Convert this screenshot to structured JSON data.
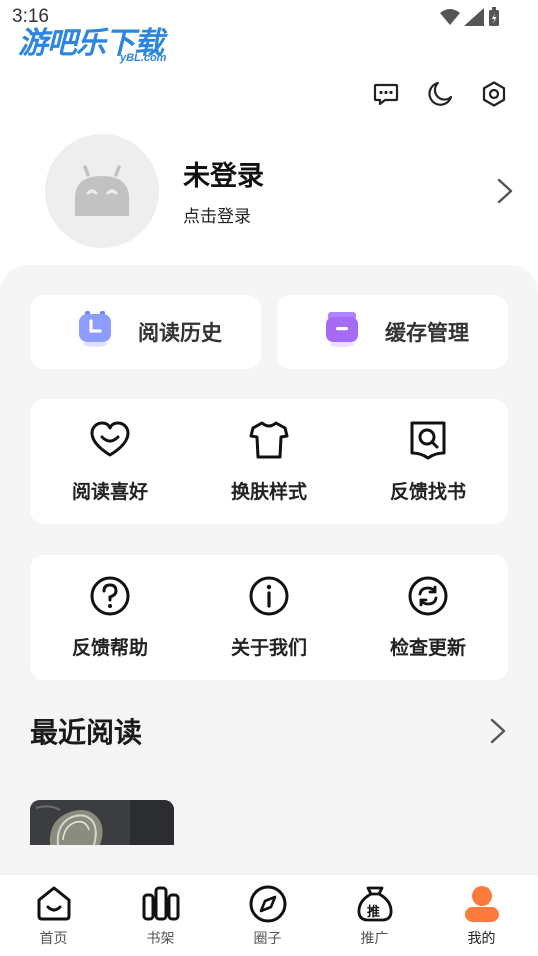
{
  "status_bar": {
    "time": "3:16"
  },
  "watermark": {
    "text": "游吧乐下载",
    "sub": "yBL.com"
  },
  "top_actions": [
    {
      "icon": "message-icon"
    },
    {
      "icon": "moon-icon"
    },
    {
      "icon": "settings-icon"
    }
  ],
  "profile": {
    "name": "未登录",
    "subtitle": "点击登录"
  },
  "quick_actions": [
    {
      "label": "阅读历史",
      "icon": "history-clock-icon",
      "color": "#7b8cff"
    },
    {
      "label": "缓存管理",
      "icon": "cache-box-icon",
      "color": "#b47cff"
    }
  ],
  "grid1": [
    {
      "label": "阅读喜好",
      "icon": "heart-smile-icon"
    },
    {
      "label": "换肤样式",
      "icon": "tshirt-icon"
    },
    {
      "label": "反馈找书",
      "icon": "book-search-icon"
    }
  ],
  "grid2": [
    {
      "label": "反馈帮助",
      "icon": "help-icon"
    },
    {
      "label": "关于我们",
      "icon": "info-icon"
    },
    {
      "label": "检查更新",
      "icon": "refresh-icon"
    }
  ],
  "recent": {
    "title": "最近阅读"
  },
  "bottom_nav": [
    {
      "label": "首页",
      "icon": "home-icon"
    },
    {
      "label": "书架",
      "icon": "bookshelf-icon"
    },
    {
      "label": "圈子",
      "icon": "compass-icon"
    },
    {
      "label": "推广",
      "icon": "promote-bag-icon",
      "badge": "推"
    },
    {
      "label": "我的",
      "icon": "profile-icon",
      "active": true,
      "color": "#ff7a3d"
    }
  ]
}
